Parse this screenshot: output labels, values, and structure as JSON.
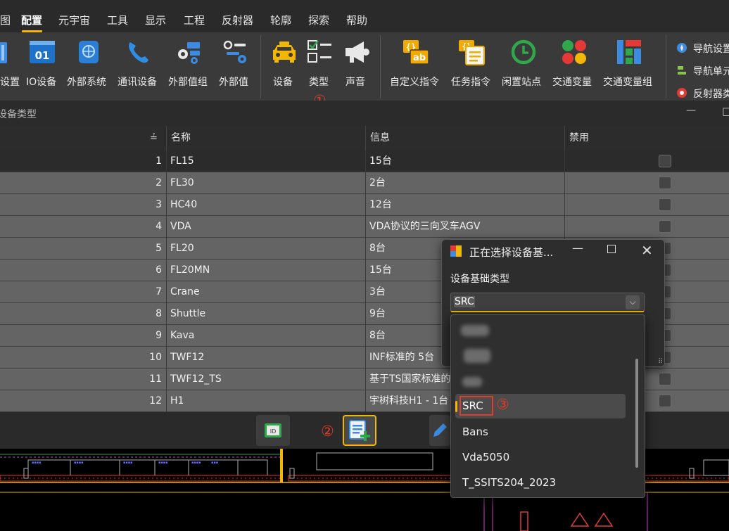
{
  "menu": {
    "items": [
      {
        "label": "图"
      },
      {
        "label": "配置"
      },
      {
        "label": "元宇宙"
      },
      {
        "label": "工具"
      },
      {
        "label": "显示"
      },
      {
        "label": "工程"
      },
      {
        "label": "反射器"
      },
      {
        "label": "轮廓"
      },
      {
        "label": "探索"
      },
      {
        "label": "帮助"
      }
    ],
    "active": "配置",
    "accent": "#f2b705"
  },
  "ribbon": {
    "buttons": [
      {
        "label": "设置",
        "icon": "settings-partial-icon"
      },
      {
        "label": "IO设备",
        "icon": "io-device-icon"
      },
      {
        "label": "外部系统",
        "icon": "external-system-icon"
      },
      {
        "label": "通讯设备",
        "icon": "phone-icon"
      },
      {
        "label": "外部值组",
        "icon": "external-value-group-icon"
      },
      {
        "label": "外部值",
        "icon": "external-value-icon"
      },
      {
        "label": "设备",
        "icon": "taxi-icon"
      },
      {
        "label": "类型",
        "icon": "checklist-icon"
      },
      {
        "label": "声音",
        "icon": "megaphone-icon"
      },
      {
        "label": "自定义指令",
        "icon": "custom-command-icon"
      },
      {
        "label": "任务指令",
        "icon": "task-command-icon"
      },
      {
        "label": "闲置站点",
        "icon": "clock-icon"
      },
      {
        "label": "交通变量",
        "icon": "traffic-variable-icon"
      },
      {
        "label": "交通变量组",
        "icon": "traffic-variable-group-icon"
      }
    ],
    "side_items": [
      {
        "label": "导航设置",
        "icon": "compass-icon"
      },
      {
        "label": "导航单元",
        "icon": "nav-unit-icon"
      },
      {
        "label": "反射器类",
        "icon": "reflector-icon"
      }
    ]
  },
  "annotations": {
    "step1": "①",
    "step2": "②",
    "step3": "③",
    "color": "#e03a2a"
  },
  "panel": {
    "title": "设备类型",
    "minimize": "—",
    "restore": "□"
  },
  "table": {
    "sort_indicator": "≟",
    "columns": [
      "名称",
      "信息",
      "禁用"
    ],
    "rows": [
      {
        "index": "1",
        "name": "FL15",
        "info": "15台",
        "disabled": false
      },
      {
        "index": "2",
        "name": "FL30",
        "info": "2台",
        "disabled": false
      },
      {
        "index": "3",
        "name": "HC40",
        "info": "12台",
        "disabled": false
      },
      {
        "index": "4",
        "name": "VDA",
        "info": "VDA协议的三向叉车AGV",
        "disabled": false
      },
      {
        "index": "5",
        "name": "FL20",
        "info": "8台",
        "disabled": false
      },
      {
        "index": "6",
        "name": "FL20MN",
        "info": "15台",
        "disabled": false
      },
      {
        "index": "7",
        "name": "Crane",
        "info": "3台",
        "disabled": false
      },
      {
        "index": "8",
        "name": "Shuttle",
        "info": "9台",
        "disabled": false
      },
      {
        "index": "9",
        "name": "Kava",
        "info": "8台",
        "disabled": false
      },
      {
        "index": "10",
        "name": "TWF12",
        "info": "INF标准的 5台",
        "disabled": false
      },
      {
        "index": "11",
        "name": "TWF12_TS",
        "info": "基于TS国家标准的",
        "disabled": false
      },
      {
        "index": "12",
        "name": "H1",
        "info": "宇树科技H1 - 1台",
        "disabled": false
      }
    ]
  },
  "toolbar": {
    "buttons": [
      {
        "name": "id-card-button",
        "icon": "id-card-icon"
      },
      {
        "name": "add-device-type-button",
        "icon": "add-list-icon",
        "highlight": "#f2b705"
      },
      {
        "name": "edit-button",
        "icon": "pencil-icon"
      }
    ]
  },
  "dialog": {
    "title": "正在选择设备基...",
    "field_label": "设备基础类型",
    "selected_value": "SRC",
    "options": [
      "SRC",
      "Bans",
      "Vda5050",
      "T_SSITS204_2023"
    ]
  }
}
